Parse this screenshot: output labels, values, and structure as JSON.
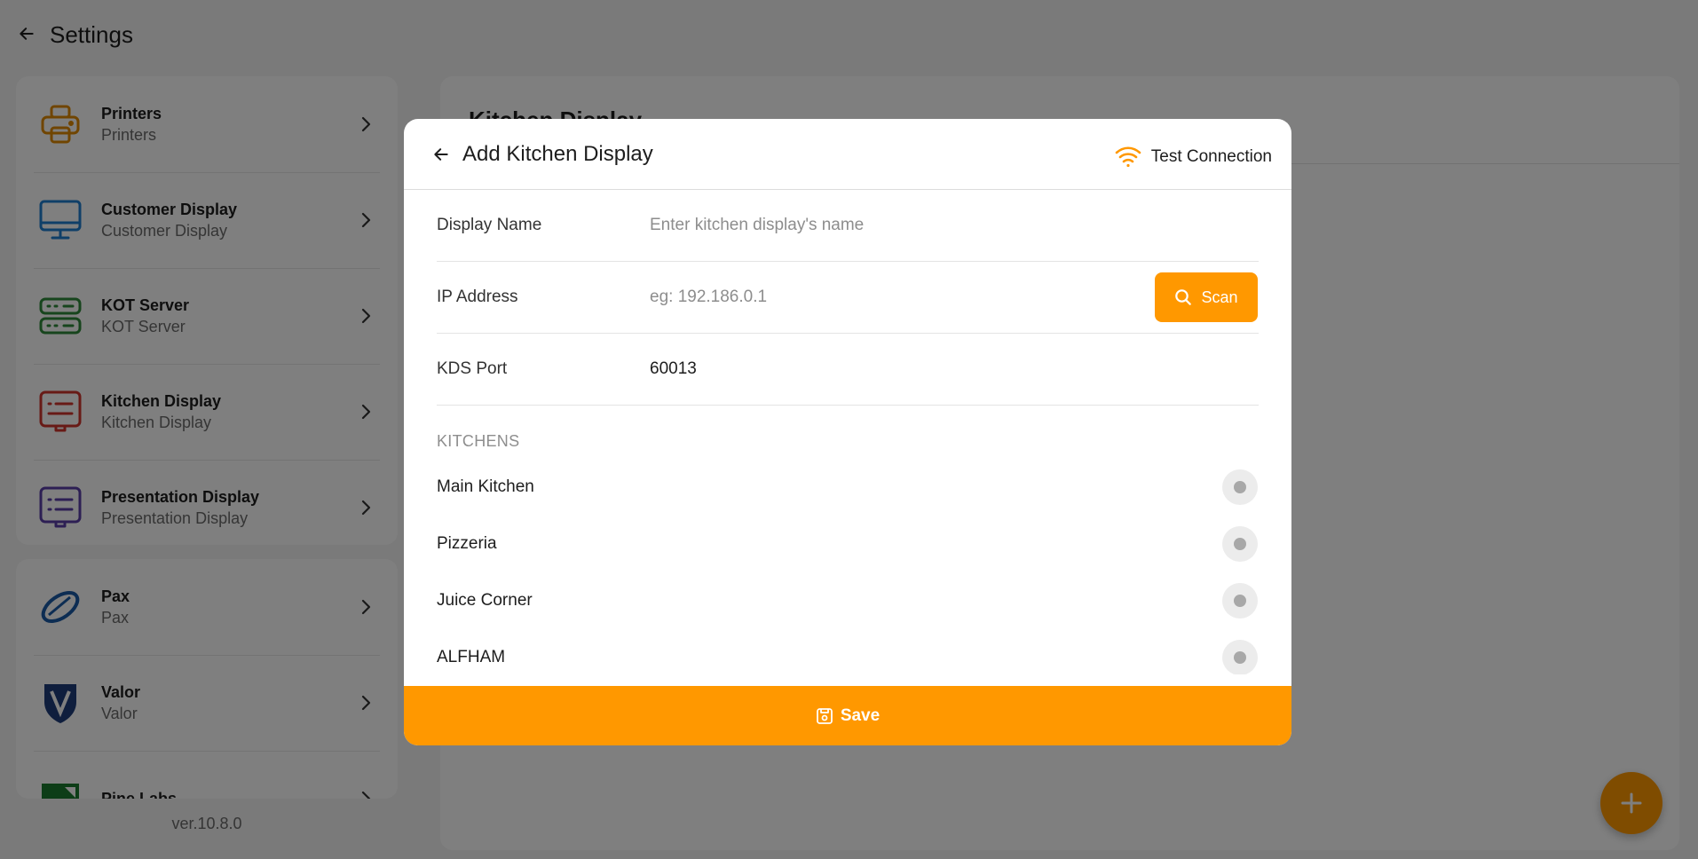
{
  "header": {
    "title": "Settings",
    "back_icon": "arrow-left-icon"
  },
  "sidebar": {
    "group_1": [
      {
        "title": "Printers",
        "subtitle": "Printers",
        "icon": "printer-icon",
        "color": "#e08a00"
      },
      {
        "title": "Customer Display",
        "subtitle": "Customer Display",
        "icon": "monitor-icon",
        "color": "#1f7ed0"
      },
      {
        "title": "KOT Server",
        "subtitle": "KOT Server",
        "icon": "server-icon",
        "color": "#2e8b3a"
      },
      {
        "title": "Kitchen Display",
        "subtitle": "Kitchen Display",
        "icon": "kitchen-display-icon",
        "color": "#d0342c"
      },
      {
        "title": "Presentation Display",
        "subtitle": "Presentation Display",
        "icon": "presentation-display-icon",
        "color": "#5b3fa8"
      }
    ],
    "group_2": [
      {
        "title": "Pax",
        "subtitle": "Pax",
        "icon": "pax-logo-icon",
        "color": "#1a5aa6"
      },
      {
        "title": "Valor",
        "subtitle": "Valor",
        "icon": "valor-shield-icon",
        "color": "#1f3d7a"
      },
      {
        "title": "Pine Labs",
        "subtitle": "",
        "icon": "pine-labs-logo-icon",
        "color": "#1b7a2e"
      }
    ],
    "version": "ver.10.8.0"
  },
  "main": {
    "title": "Kitchen Display",
    "fab_icon": "plus-icon"
  },
  "modal": {
    "title": "Add Kitchen Display",
    "test_connection_label": "Test Connection",
    "display_name": {
      "label": "Display Name",
      "value": "",
      "placeholder": "Enter kitchen display's name"
    },
    "ip_address": {
      "label": "IP Address",
      "value": "",
      "placeholder": "eg: 192.186.0.1",
      "scan_label": "Scan"
    },
    "kds_port": {
      "label": "KDS Port",
      "value": "60013",
      "placeholder": ""
    },
    "kitchens_label": "KITCHENS",
    "kitchens": [
      {
        "name": "Main Kitchen",
        "selected": false
      },
      {
        "name": "Pizzeria",
        "selected": false
      },
      {
        "name": "Juice Corner",
        "selected": false
      },
      {
        "name": "ALFHAM",
        "selected": false
      }
    ],
    "save_label": "Save"
  },
  "colors": {
    "accent": "#ff9800",
    "overlay": "rgba(0,0,0,0.5)"
  }
}
